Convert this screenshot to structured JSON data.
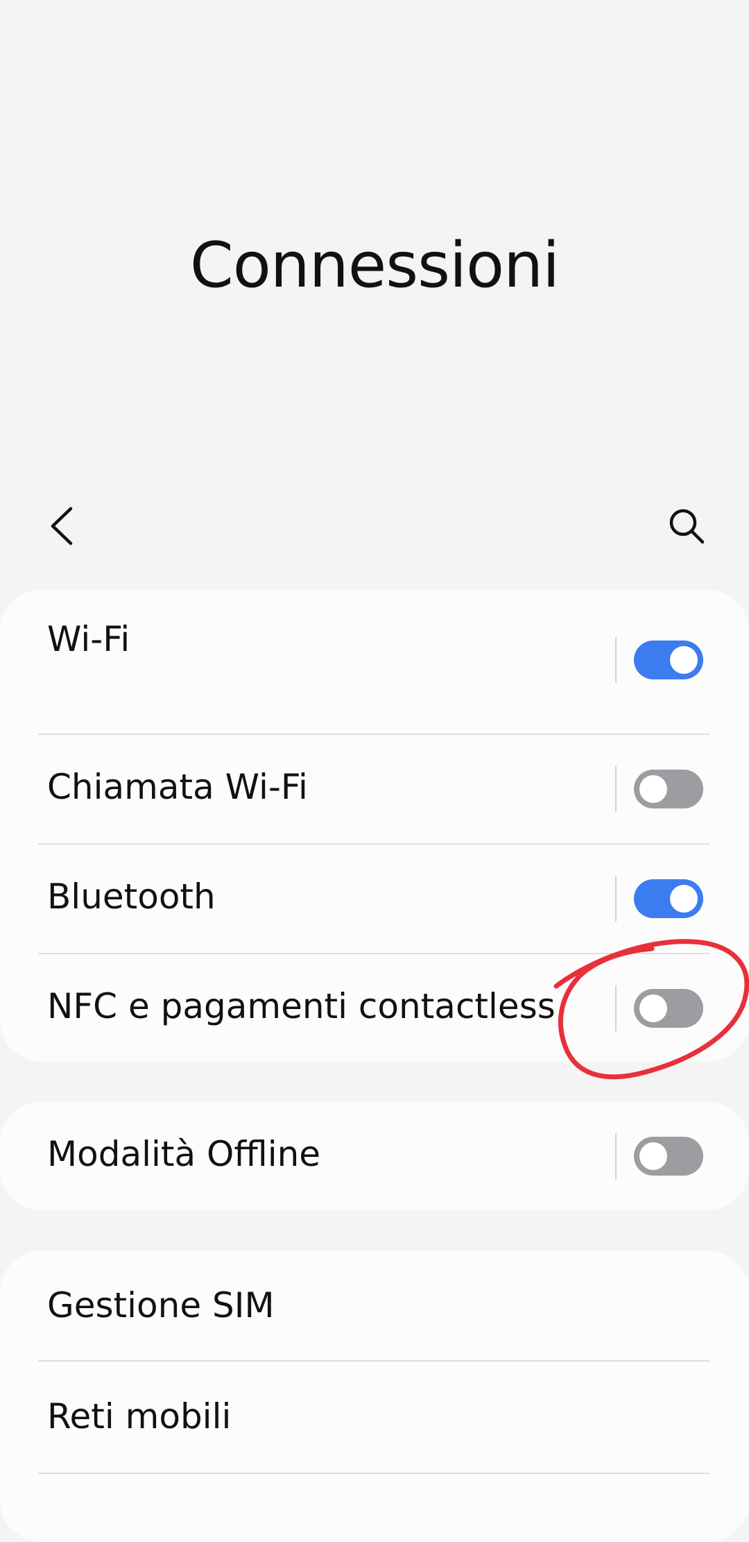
{
  "header": {
    "title": "Connessioni"
  },
  "nav": {
    "back_icon": "chevron-left-icon",
    "search_icon": "search-icon"
  },
  "settings": {
    "wifi": {
      "label": "Wi-Fi",
      "enabled": true
    },
    "wifi_calling": {
      "label": "Chiamata Wi-Fi",
      "enabled": false
    },
    "bluetooth": {
      "label": "Bluetooth",
      "enabled": true
    },
    "nfc": {
      "label": "NFC e pagamenti contactless",
      "enabled": false
    },
    "offline_mode": {
      "label": "Modalità Offline",
      "enabled": false
    },
    "sim_manager": {
      "label": "Gestione SIM"
    },
    "mobile_networks": {
      "label": "Reti mobili"
    }
  },
  "colors": {
    "toggle_on": "#3b7cf0",
    "toggle_off": "#9c9ca1",
    "annotation": "#e8303a"
  }
}
